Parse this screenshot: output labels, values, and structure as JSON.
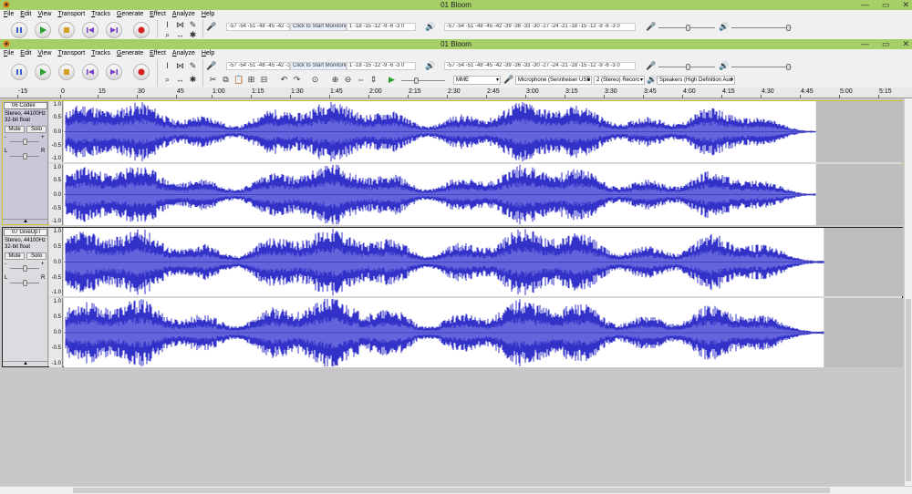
{
  "windows": [
    {
      "title": "01 Bloom"
    },
    {
      "title": "01 Bloom"
    }
  ],
  "window_buttons": {
    "min": "—",
    "max": "▭",
    "close": "✕"
  },
  "menu": [
    "File",
    "Edit",
    "View",
    "Transport",
    "Tracks",
    "Generate",
    "Effect",
    "Analyze",
    "Help"
  ],
  "meters": {
    "record_meter": "-57 -54 -51 -48 -45 -42 -3",
    "record_monitor": "Click to Start Monitoring",
    "record_meter_tail": "1 -18 -15 -12 -9 -6 -3 0",
    "playback_meter": "-57 -54 -51 -48 -45 -42 -39 -36 -33 -30 -27 -24 -21 -18 -15 -12 -9 -6 -3 0",
    "lr": "L R"
  },
  "devices": {
    "host": "MME",
    "microphone": "Microphone (Sennheiser USB I",
    "channels": "2 (Stereo) Recorc",
    "speakers": "Speakers (High Definition Aud"
  },
  "ruler": {
    "ticks": [
      "-15",
      "0",
      "15",
      "30",
      "45",
      "1:00",
      "1:15",
      "1:30",
      "1:45",
      "2:00",
      "2:15",
      "2:30",
      "2:45",
      "3:00",
      "3:15",
      "3:30",
      "3:45",
      "4:00",
      "4:15",
      "4:30",
      "4:45",
      "5:00",
      "5:15"
    ]
  },
  "tracks": [
    {
      "name": "06 Codex",
      "format": "Stereo, 44100Hz",
      "bits": "32-bit float",
      "mute": "Mute",
      "solo": "Solo",
      "gain_minus": "-",
      "gain_plus": "+",
      "pan_l": "L",
      "pan_r": "R",
      "collapse": "▲",
      "scale": [
        "1.0",
        "0.5",
        "0.0",
        "-0.5",
        "-1.0"
      ],
      "length_seconds": 287
    },
    {
      "name": "07 GiveUpT",
      "format": "Stereo, 44100Hz",
      "bits": "32-bit float",
      "mute": "Mute",
      "solo": "Solo",
      "gain_minus": "-",
      "gain_plus": "+",
      "pan_l": "L",
      "pan_r": "R",
      "collapse": "▲",
      "scale": [
        "1.0",
        "0.5",
        "0.0",
        "-0.5",
        "-1.0"
      ],
      "length_seconds": 290
    }
  ],
  "colors": {
    "titlebar": "#a6cf68",
    "wave": "#3232c8",
    "wave_rms": "#6464dc",
    "wave_bg": "#bdbdbd",
    "selected_border": "#d4c02a"
  }
}
